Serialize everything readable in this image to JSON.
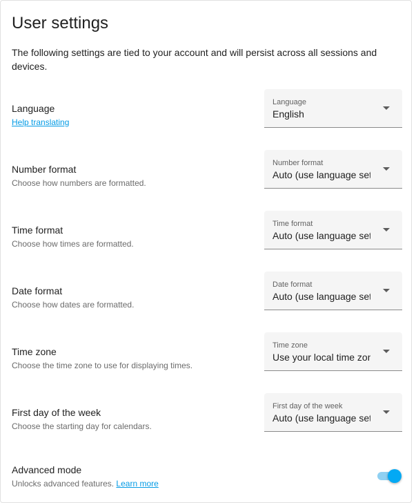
{
  "page": {
    "title": "User settings",
    "description": "The following settings are tied to your account and will persist across all sessions and devices."
  },
  "settings": [
    {
      "label": "Language",
      "sub": "",
      "link": "Help translating",
      "select_label": "Language",
      "select_value": "English"
    },
    {
      "label": "Number format",
      "sub": "Choose how numbers are formatted.",
      "select_label": "Number format",
      "select_value": "Auto (use language setting)"
    },
    {
      "label": "Time format",
      "sub": "Choose how times are formatted.",
      "select_label": "Time format",
      "select_value": "Auto (use language setting)"
    },
    {
      "label": "Date format",
      "sub": "Choose how dates are formatted.",
      "select_label": "Date format",
      "select_value": "Auto (use language setting)"
    },
    {
      "label": "Time zone",
      "sub": "Choose the time zone to use for displaying times.",
      "select_label": "Time zone",
      "select_value": "Use your local time zone"
    },
    {
      "label": "First day of the week",
      "sub": "Choose the starting day for calendars.",
      "select_label": "First day of the week",
      "select_value": "Auto (use language setting)"
    }
  ],
  "advanced": {
    "label": "Advanced mode",
    "sub": "Unlocks advanced features.",
    "link": "Learn more",
    "enabled": true
  },
  "colors": {
    "accent": "#03a9f4",
    "link": "#039be5"
  }
}
